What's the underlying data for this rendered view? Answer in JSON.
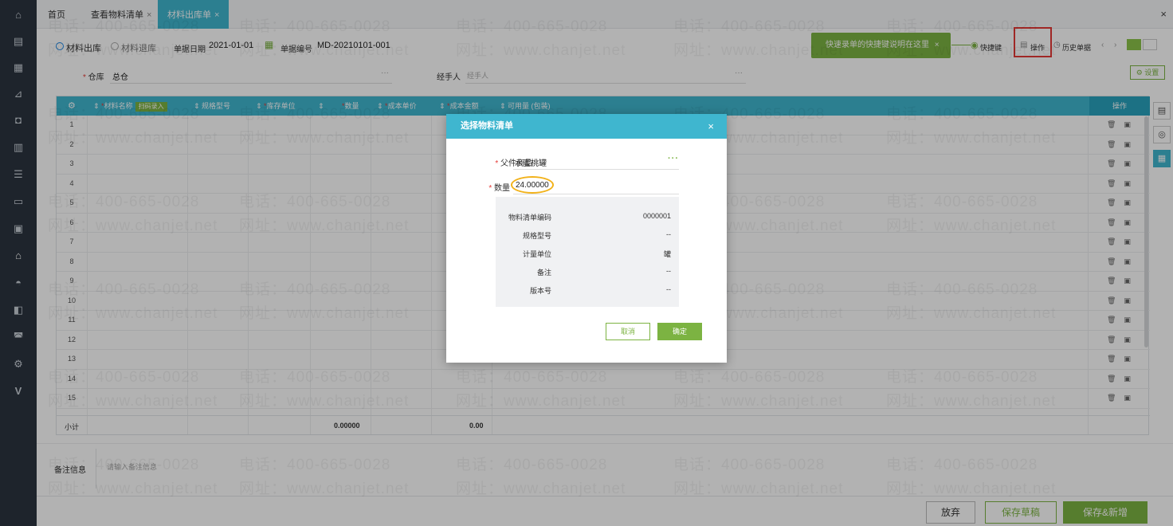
{
  "left_rail": {
    "icons": [
      "home-icon",
      "inventory-icon",
      "document-icon",
      "chart-icon",
      "bag-icon",
      "building-icon",
      "list-icon",
      "store-icon",
      "wallet-icon",
      "factory-icon",
      "coin-icon",
      "invoice-icon",
      "archive-icon",
      "gear-icon",
      "v-icon"
    ]
  },
  "tabs": [
    {
      "label": "首页",
      "closable": false
    },
    {
      "label": "查看物料清单",
      "closable": true
    },
    {
      "label": "材料出库单",
      "closable": true,
      "active": true
    }
  ],
  "tab_close_glyph": "×",
  "close_all_glyph": "×",
  "toolbar": {
    "mode_out": "材料出库",
    "mode_return": "材料退库",
    "date_label": "单据日期",
    "date_value": "2021-01-01",
    "number_label": "单据编号",
    "number_value": "MD-20210101-001",
    "tip_text": "快速录单的快捷键说明在这里",
    "tip_close": "×",
    "shortcut_label": "快捷键",
    "operation_label": "操作",
    "history_label": "历史单据"
  },
  "form": {
    "warehouse_label": "仓库",
    "warehouse_value": "总仓",
    "handler_label": "经手人",
    "handler_placeholder": "经手人",
    "more": "···",
    "settings_label": "设置"
  },
  "grid": {
    "headers": {
      "name": "材料名称",
      "scan": "扫码录入",
      "spec": "规格型号",
      "unit": "库存单位",
      "qty": "数量",
      "cost_price": "成本单价",
      "cost_amount": "成本金额",
      "available": "可用量 (包装)",
      "ops": "操作"
    },
    "rows": [
      "1",
      "2",
      "3",
      "4",
      "5",
      "6",
      "7",
      "8",
      "9",
      "10",
      "11",
      "12",
      "13",
      "14",
      "15"
    ],
    "subtotal_label": "小计",
    "subtotal_qty": "0.00000",
    "subtotal_amount": "0.00"
  },
  "remarks": {
    "label": "备注信息",
    "placeholder": "请输入备注信息"
  },
  "footer": {
    "discard": "放弃",
    "save_draft": "保存草稿",
    "save_new": "保存&新增"
  },
  "watermark": {
    "phone": "电话：400-665-0028",
    "url": "网址：www.chanjet.net"
  },
  "modal": {
    "title": "选择物料清单",
    "close": "×",
    "parent_label": "父件商品",
    "parent_value": "水蜜桃罐",
    "more": "···",
    "qty_label": "数量",
    "qty_value": "24.00000",
    "info": [
      {
        "k": "物料清单编码",
        "v": "0000001"
      },
      {
        "k": "规格型号",
        "v": "--"
      },
      {
        "k": "计量单位",
        "v": "罐"
      },
      {
        "k": "备注",
        "v": "--"
      },
      {
        "k": "版本号",
        "v": "--"
      }
    ],
    "cancel": "取消",
    "confirm": "确定"
  },
  "colors": {
    "accent": "#3fb6cf",
    "green": "#7cb342",
    "rail": "#2b3440",
    "highlight_red": "#e53935",
    "highlight_ellipse": "#f2b21a"
  }
}
